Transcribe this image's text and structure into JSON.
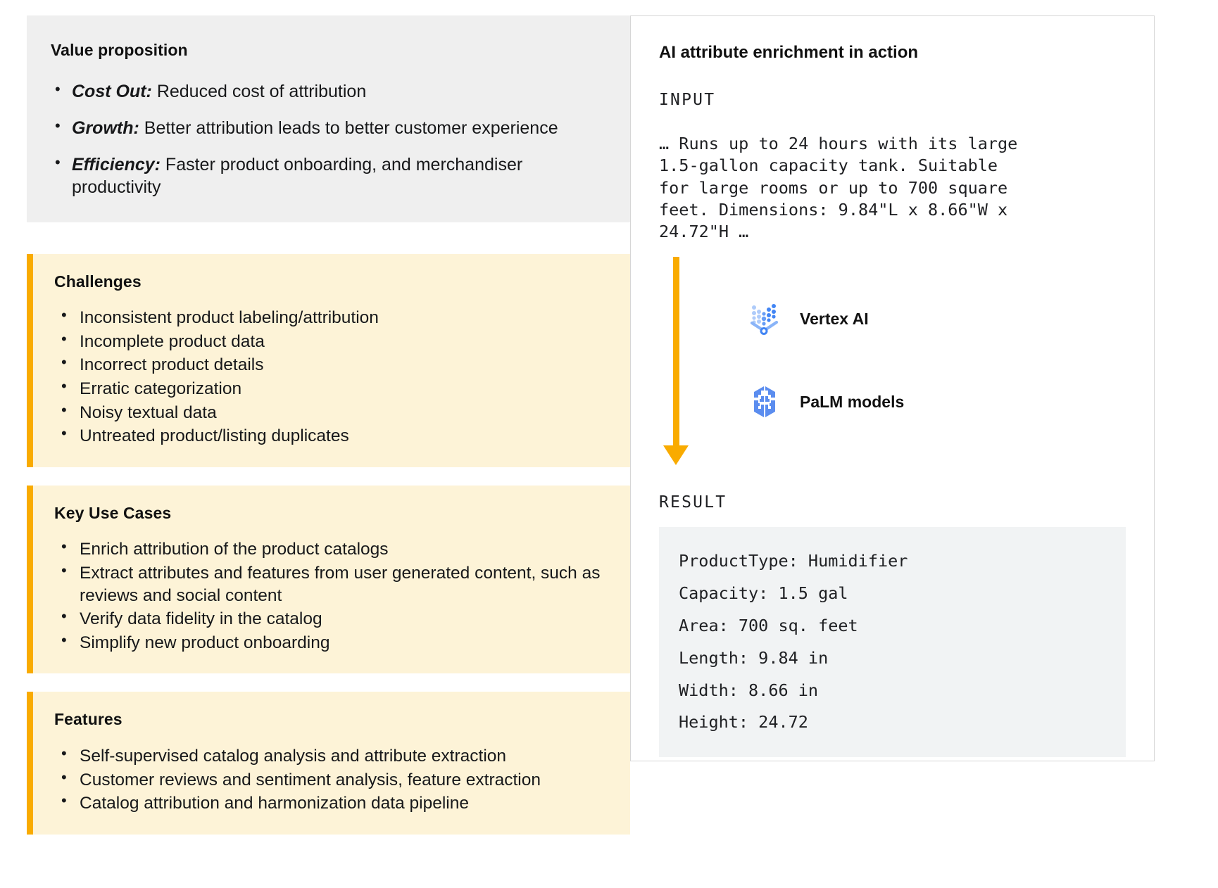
{
  "left": {
    "value_proposition": {
      "title": "Value proposition",
      "items": [
        {
          "lead": "Cost Out:",
          "text": " Reduced cost of attribution"
        },
        {
          "lead": "Growth:",
          "text": " Better attribution leads to better customer experience"
        },
        {
          "lead": "Efficiency:",
          "text": " Faster product onboarding, and merchandiser productivity"
        }
      ]
    },
    "challenges": {
      "title": "Challenges",
      "items": [
        "Inconsistent product labeling/attribution",
        "Incomplete product data",
        "Incorrect product details",
        "Erratic categorization",
        "Noisy textual data",
        "Untreated product/listing duplicates"
      ]
    },
    "key_use_cases": {
      "title": "Key Use Cases",
      "items": [
        "Enrich attribution of the product catalogs",
        "Extract attributes and features from user generated content, such as reviews and social content",
        "Verify data fidelity in the catalog",
        "Simplify new product onboarding"
      ]
    },
    "features": {
      "title": "Features",
      "items": [
        "Self-supervised catalog analysis and attribute extraction",
        "Customer reviews and sentiment analysis, feature extraction",
        "Catalog attribution and harmonization data pipeline"
      ]
    }
  },
  "right": {
    "title": "AI attribute enrichment in action",
    "input_label": "INPUT",
    "input_text": "… Runs up to 24 hours with its large\n1.5-gallon capacity tank. Suitable\nfor large rooms or up to 700 square\nfeet. Dimensions: 9.84\"L x 8.66\"W x\n24.72\"H …",
    "models": [
      {
        "icon": "vertex-ai-icon",
        "label": "Vertex AI"
      },
      {
        "icon": "palm-models-icon",
        "label": "PaLM models"
      }
    ],
    "result_label": "RESULT",
    "result_lines": [
      "ProductType: Humidifier",
      "Capacity: 1.5 gal",
      "Area: 700 sq. feet",
      "Length: 9.84 in",
      "Width: 8.66 in",
      "Height: 24.72"
    ]
  },
  "colors": {
    "accent_amber": "#f9ab00",
    "card_amber_bg": "#fdf3d7",
    "card_grey_bg": "#efefef",
    "result_bg": "#f1f3f4",
    "icon_blue": "#4285f4",
    "icon_blue_light": "#a0c3ff"
  }
}
